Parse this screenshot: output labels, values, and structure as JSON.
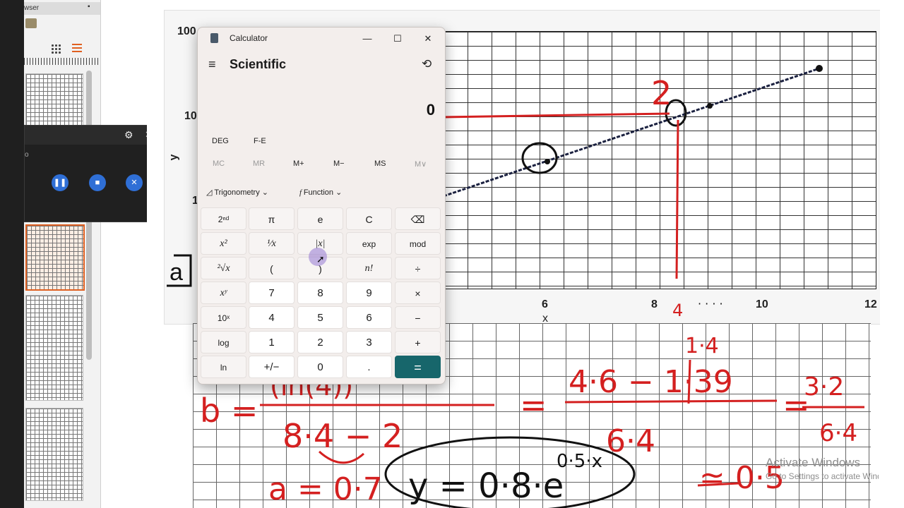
{
  "browser": {
    "title_fragment": "wser"
  },
  "recorder": {
    "side_text": "o"
  },
  "graph": {
    "y_axis_label": "y",
    "x_axis_label": "x",
    "y_ticks": [
      "100",
      "10",
      "1"
    ],
    "x_ticks": [
      "6",
      "8",
      "10",
      "12"
    ]
  },
  "calculator": {
    "title": "Calculator",
    "mode": "Scientific",
    "display": "0",
    "angle_unit": "DEG",
    "fe": "F-E",
    "memory": [
      "MC",
      "MR",
      "M+",
      "M−",
      "MS",
      "M∨"
    ],
    "dropdowns": {
      "trigonometry": "Trigonometry",
      "function": "Function"
    },
    "keys": [
      [
        "2ⁿᵈ",
        "π",
        "e",
        "C",
        "⌫"
      ],
      [
        "x²",
        "¹⁄x",
        "|x|",
        "exp",
        "mod"
      ],
      [
        "²√x",
        "(",
        ")",
        "n!",
        "÷"
      ],
      [
        "xʸ",
        "7",
        "8",
        "9",
        "×"
      ],
      [
        "10ˣ",
        "4",
        "5",
        "6",
        "−"
      ],
      [
        "log",
        "1",
        "2",
        "3",
        "+"
      ],
      [
        "ln",
        "+/−",
        "0",
        ".",
        "="
      ]
    ]
  },
  "handwriting": {
    "graph_marks": [
      "2",
      "4",
      "· · · ·"
    ],
    "fraction_line_1": "= 4·6 − 1·39 = 3·2",
    "numerators": [
      "(ln(4))",
      "4·6 − 1·39",
      "3·2"
    ],
    "denominators": [
      "8·4 − 2",
      "6·4",
      "6·4"
    ],
    "top_note": "1·4",
    "b_label": "b =",
    "result": "≃ 0·5",
    "a_line": "a = 0·7",
    "equation": "y = 0·8·e",
    "exponent": "0·5·x"
  },
  "watermark": {
    "line1": "Activate Windows",
    "line2": "Go to Settings to activate Windows."
  },
  "colors": {
    "calc_bg": "#f3eeec",
    "equals_key": "#17666b",
    "ink_red": "#d42020",
    "ink_black": "#111111",
    "recorder_button": "#2f6fd6"
  }
}
